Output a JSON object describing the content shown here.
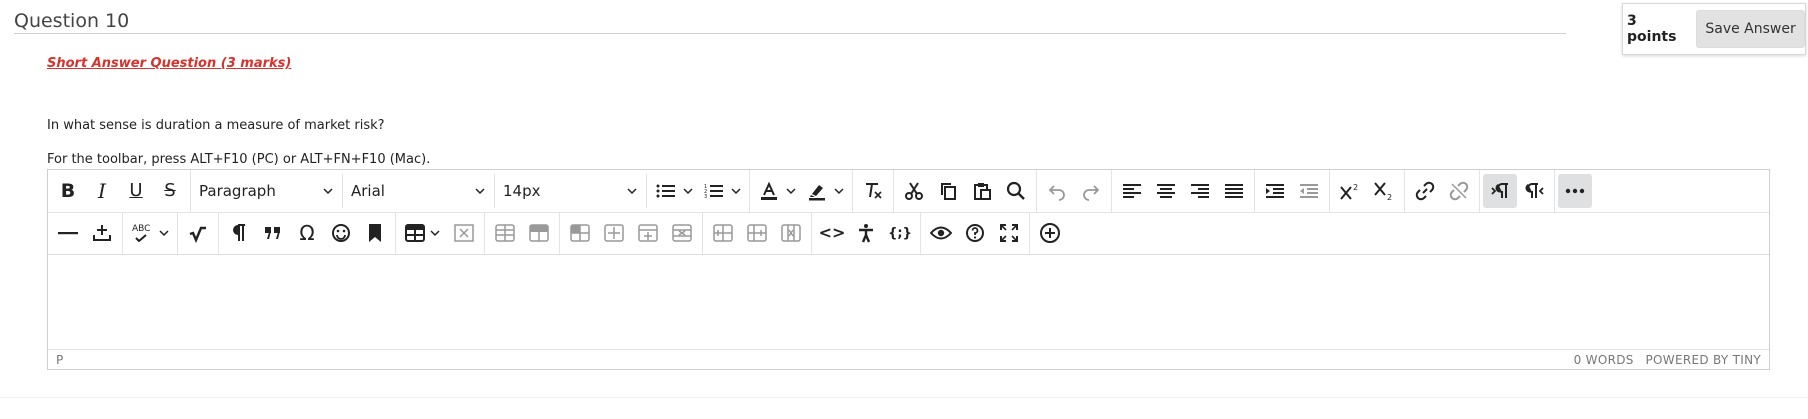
{
  "question": {
    "title": "Question 10",
    "points": "3 points",
    "save_label": "Save Answer",
    "section_title": "Short Answer Question (3 marks)",
    "prompt": "In what sense is duration a measure of market risk?",
    "toolbar_hint": "For the toolbar, press ALT+F10 (PC) or ALT+FN+F10 (Mac)."
  },
  "editor": {
    "block_format": "Paragraph",
    "font_family": "Arial",
    "font_size": "14px",
    "status_path": "P",
    "word_count": "0 WORDS",
    "powered_by": "POWERED BY TINY"
  },
  "toolbar": {
    "bold": "B",
    "italic": "I",
    "underline": "U",
    "strike": "S",
    "spellcheck": "ABC",
    "special_char": "Ω",
    "code": "<>",
    "source_code": "{;}"
  }
}
